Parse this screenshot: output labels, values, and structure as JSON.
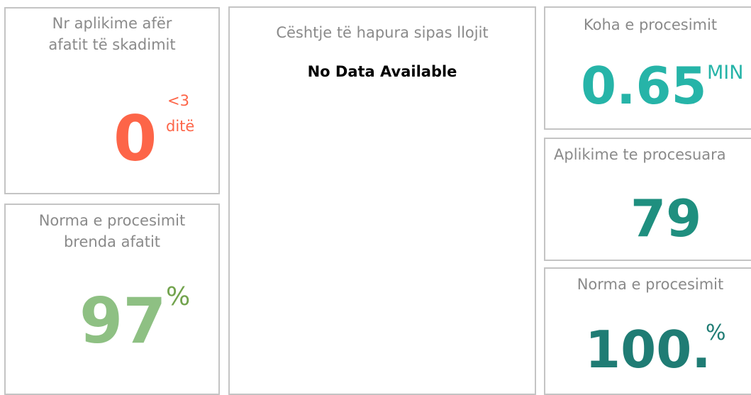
{
  "cards": {
    "deadline": {
      "title_line1": "Nr aplikime afër",
      "title_line2": "afatit të skadimit",
      "value": "0",
      "unit_line1": "<3",
      "unit_line2": "ditë"
    },
    "ontime": {
      "title_line1": "Norma e procesimit",
      "title_line2": "brenda afatit",
      "value": "97",
      "unit": "%"
    },
    "cases": {
      "title": "Cështje të hapura sipas llojit",
      "empty_message": "No Data Available"
    },
    "time": {
      "title": "Koha e procesimit",
      "value": "0.65",
      "unit": "MIN"
    },
    "processed": {
      "title": "Aplikime te procesuara",
      "value": "79"
    },
    "rate": {
      "title": "Norma e procesimit",
      "value": "100.",
      "unit": "%"
    }
  },
  "colors": {
    "deadline": "#fd6548",
    "ontime_value": "#8ec083",
    "ontime_unit": "#72a34d",
    "time": "#26b4a8",
    "processed": "#1f8f7f",
    "rate": "#1f7c74",
    "title_gray": "#8a8a8a",
    "border": "#c4c4c4"
  }
}
